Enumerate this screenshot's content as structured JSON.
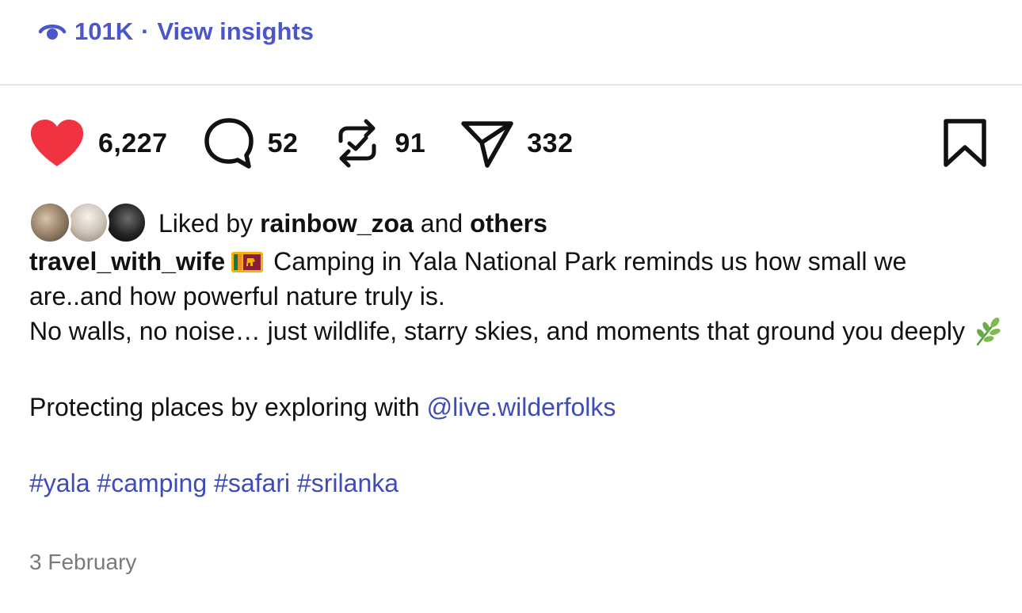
{
  "insights": {
    "views": "101K",
    "separator": "·",
    "label": "View insights",
    "icon": "eye-icon",
    "color": "#4a56c9"
  },
  "actions": {
    "likes": "6,227",
    "comments": "52",
    "reposts": "91",
    "shares": "332",
    "liked_color": "#ef3340"
  },
  "liked_by": {
    "prefix": "Liked by",
    "user": "rainbow_zoa",
    "conjunction": "and",
    "others": "others"
  },
  "caption": {
    "username": "travel_with_wife",
    "line1": " Camping in Yala National Park reminds us how small we are..and how powerful nature truly is.",
    "line2": "No walls, no noise… just wildlife, starry skies, and moments that ground you deeply",
    "line3_prefix": "Protecting places by exploring with ",
    "mention": "@live.wilderfolks",
    "hashtags": "#yala #camping #safari #srilanka",
    "link_color": "#3e4cb8"
  },
  "date": "3 February"
}
